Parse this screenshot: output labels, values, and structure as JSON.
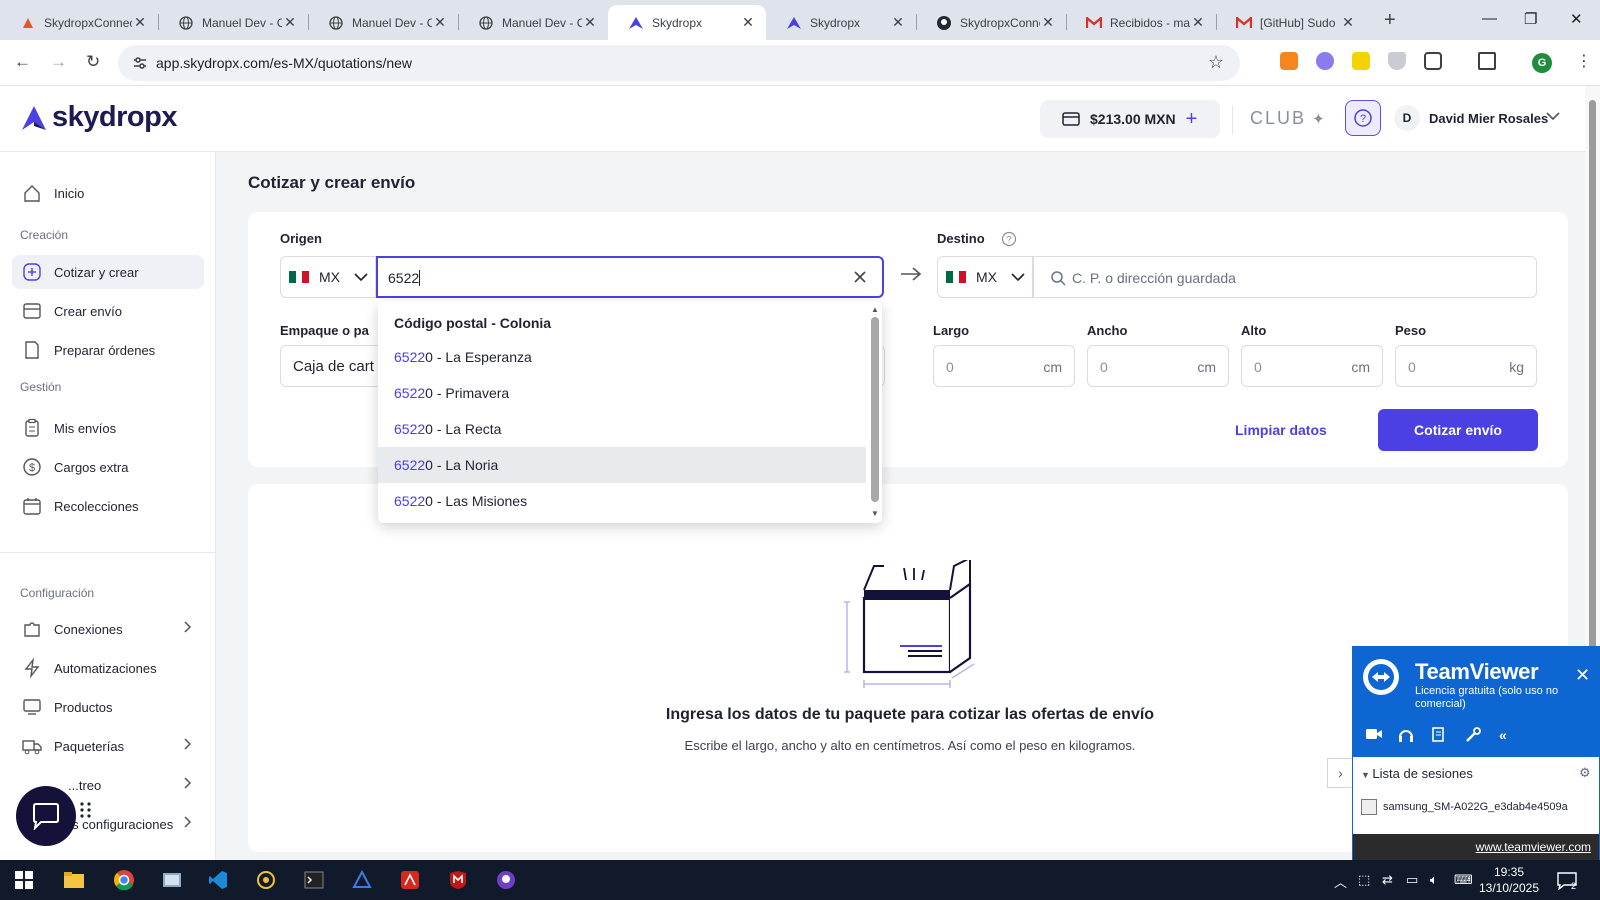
{
  "browser": {
    "tabs": [
      {
        "title": "SkydropxConnector",
        "active": false
      },
      {
        "title": "Manuel Dev - C",
        "active": false
      },
      {
        "title": "Manuel Dev - C",
        "active": false
      },
      {
        "title": "Manuel Dev - C",
        "active": false
      },
      {
        "title": "Skydropx",
        "active": true
      },
      {
        "title": "Skydropx",
        "active": false
      },
      {
        "title": "SkydropxConnector",
        "active": false
      },
      {
        "title": "Recibidos - ma",
        "active": false
      },
      {
        "title": "[GitHub] Sudo",
        "active": false
      }
    ],
    "url": "app.skydropx.com/es-MX/quotations/new",
    "profile_initial": "G"
  },
  "header": {
    "logo": "skydropx",
    "balance": "$213.00 MXN",
    "club": "CLUB",
    "avatar_initial": "D",
    "user_name": "David Mier Rosales"
  },
  "sidebar": {
    "home": "Inicio",
    "section_creation": "Creación",
    "quote_create": "Cotizar y crear",
    "create_shipment": "Crear envío",
    "prepare_orders": "Preparar órdenes",
    "section_management": "Gestión",
    "my_shipments": "Mis envíos",
    "extra_charges": "Cargos extra",
    "pickups": "Recolecciones",
    "section_config": "Configuración",
    "connections": "Conexiones",
    "automations": "Automatizaciones",
    "products": "Productos",
    "carriers": "Paqueterías",
    "partial_item": "...treo",
    "more_config": "...ás configuraciones"
  },
  "main": {
    "title": "Cotizar y crear envío",
    "origin_label": "Origen",
    "origin_country": "MX",
    "origin_value": "6522",
    "destination_label": "Destino",
    "destination_country": "MX",
    "destination_placeholder": "C. P. o dirección guardada",
    "package_label": "Empaque o pa",
    "package_value": "Caja de cart",
    "length_label": "Largo",
    "width_label": "Ancho",
    "height_label": "Alto",
    "weight_label": "Peso",
    "length_value": "0",
    "width_value": "0",
    "height_value": "0",
    "weight_value": "0",
    "unit_cm": "cm",
    "unit_kg": "kg",
    "clear_button": "Limpiar datos",
    "quote_button": "Cotizar envío",
    "empty_title": "Ingresa los datos de tu paquete para cotizar las ofertas de envío",
    "empty_subtitle": "Escribe el largo, ancho y alto en centímetros. Así como el peso en kilogramos."
  },
  "dropdown": {
    "header": "Código postal - Colonia",
    "options": [
      {
        "match": "6522",
        "rest": "0 - La Esperanza"
      },
      {
        "match": "6522",
        "rest": "0 - Primavera"
      },
      {
        "match": "6522",
        "rest": "0 - La Recta"
      },
      {
        "match": "6522",
        "rest": "0 - La Noria"
      },
      {
        "match": "6522",
        "rest": "0 - Las Misiones"
      }
    ],
    "hovered_index": 3
  },
  "teamviewer": {
    "name": "TeamViewer",
    "license": "Licencia gratuita (solo uso no comercial)",
    "sessions_label": "Lista de sesiones",
    "device": "samsung_SM-A022G_e3dab4e4509a",
    "link": "www.teamviewer.com"
  },
  "taskbar": {
    "time": "19:35",
    "date": "13/10/2025",
    "notifications": "2"
  },
  "colors": {
    "accent": "#4b40e3",
    "brand_dark": "#1d1b4f",
    "teamviewer_blue": "#0e66d3"
  }
}
